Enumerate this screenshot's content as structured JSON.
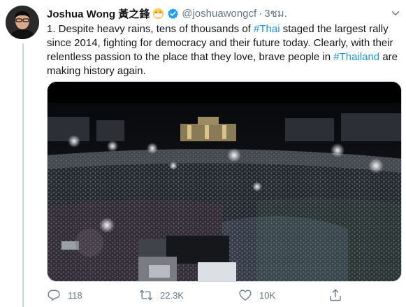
{
  "tweet": {
    "author": {
      "display_name": "Joshua Wong 黃之鋒",
      "handle": "@joshuawongcf",
      "avatar_icon": "profile-photo",
      "verified": true
    },
    "separator": "·",
    "timestamp": "3ชม.",
    "text_parts": [
      {
        "type": "text",
        "value": "1. Despite heavy rains, tens of thousands of "
      },
      {
        "type": "hashtag",
        "value": "#Thai"
      },
      {
        "type": "text",
        "value": " staged the largest rally since 2014, fighting for democracy and their future today. Clearly, with their relentless passion to the place that they love, brave people in "
      },
      {
        "type": "hashtag",
        "value": "#Thailand"
      },
      {
        "type": "text",
        "value": " are making history again."
      }
    ],
    "media": {
      "icon": "crowd-photo"
    },
    "actions": {
      "reply_count": "118",
      "retweet_count": "22.3K",
      "like_count": "10K",
      "share_icon": "share-icon"
    }
  },
  "colors": {
    "link": "#1b95e0",
    "secondary_text": "#657786",
    "verified": "#1da1f2",
    "border": "#ccd6dd"
  }
}
